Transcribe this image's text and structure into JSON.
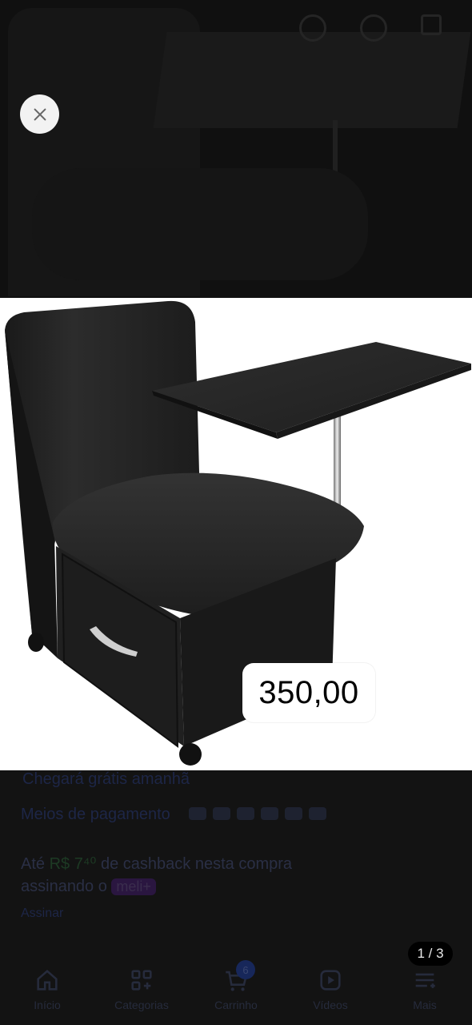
{
  "overlay": {
    "close_icon": "close-icon",
    "price": "350,00",
    "counter": "1 / 3"
  },
  "background": {
    "delivery_line": "Chegará grátis amanhã",
    "payment_label": "Meios de pagamento",
    "payment_icons": [
      "mercado-pago",
      "pix",
      "mastercard",
      "visa",
      "elo",
      "boleto"
    ],
    "cashback_prefix": "Até ",
    "cashback_amount": "R$ 7⁴⁰",
    "cashback_suffix": " de cashback nesta compra",
    "cashback_line2": "assinando o ",
    "meli_badge": "meli+",
    "subscribe_link": "Assinar"
  },
  "bottom_nav": {
    "items": [
      {
        "label": "Início",
        "icon": "home-icon"
      },
      {
        "label": "Categorias",
        "icon": "grid-icon"
      },
      {
        "label": "Carrinho",
        "icon": "cart-icon",
        "badge": "6"
      },
      {
        "label": "Vídeos",
        "icon": "play-icon"
      },
      {
        "label": "Mais",
        "icon": "menu-icon"
      }
    ]
  },
  "colors": {
    "overlay_background": "#131313",
    "badge": "#ffffff",
    "counter_background": "#000000"
  }
}
